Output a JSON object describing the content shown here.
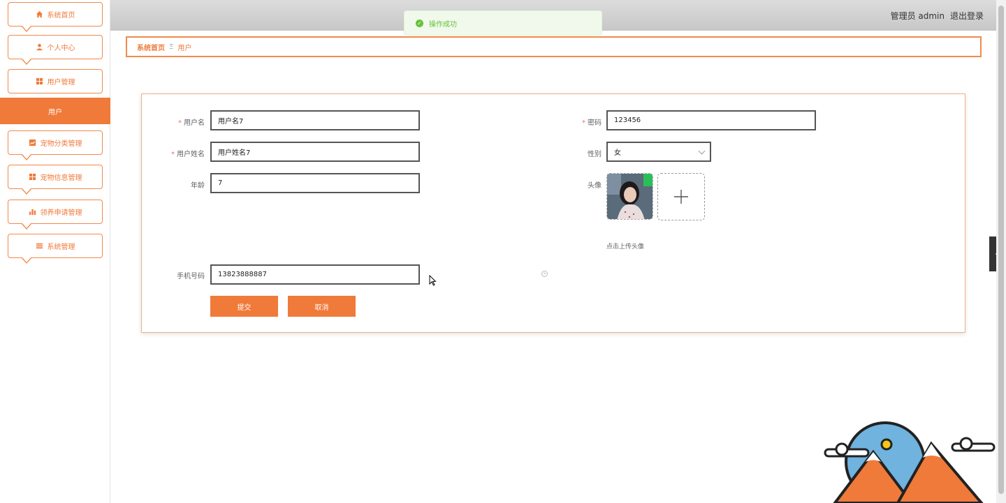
{
  "sidebar": {
    "items": [
      {
        "label": "系统首页",
        "icon": "home-icon"
      },
      {
        "label": "个人中心",
        "icon": "user-icon"
      },
      {
        "label": "用户管理",
        "icon": "grid-icon"
      },
      {
        "label": "宠物分类管理",
        "icon": "chart-icon"
      },
      {
        "label": "宠物信息管理",
        "icon": "grid-icon"
      },
      {
        "label": "领养申请管理",
        "icon": "bar-chart-icon"
      },
      {
        "label": "系统管理",
        "icon": "list-icon"
      }
    ],
    "active_submenu": "用户"
  },
  "header": {
    "user": "管理员 admin",
    "logout": "退出登录"
  },
  "toast": {
    "message": "操作成功"
  },
  "breadcrumb": {
    "home": "系统首页",
    "separator": "Ξ",
    "current": "用户"
  },
  "form": {
    "username_label": "用户名",
    "username_value": "用户名7",
    "password_label": "密码",
    "password_value": "123456",
    "realname_label": "用户姓名",
    "realname_value": "用户姓名7",
    "gender_label": "性别",
    "gender_value": "女",
    "age_label": "年龄",
    "age_value": "7",
    "avatar_label": "头像",
    "upload_hint": "点击上传头像",
    "phone_label": "手机号码",
    "phone_value": "13823888887",
    "submit_label": "提交",
    "cancel_label": "取消"
  },
  "colors": {
    "accent": "#f07a3a",
    "success": "#67c23a",
    "required": "#f56c6c"
  }
}
